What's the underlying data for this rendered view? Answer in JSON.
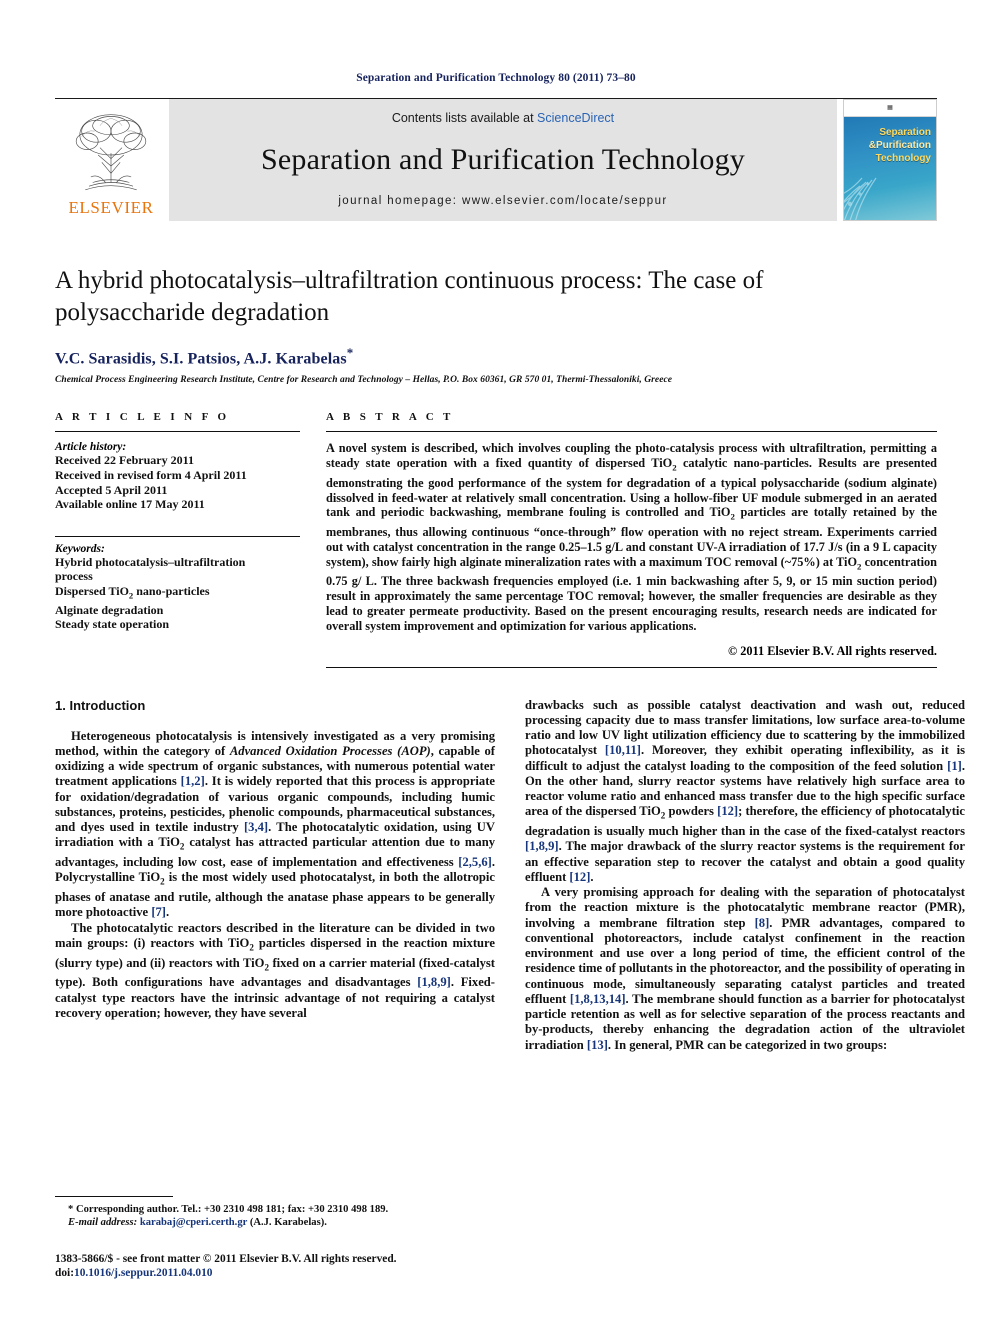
{
  "running_head": "Separation and Purification Technology 80 (2011) 73–80",
  "masthead": {
    "contents_prefix": "Contents lists available at ",
    "sciencedirect": "ScienceDirect",
    "journal_name": "Separation and Purification Technology",
    "homepage": "journal homepage: www.elsevier.com/locate/seppur",
    "publisher_logo_text": "ELSEVIER",
    "cover": {
      "line1": "Separation",
      "line2": "&Purification",
      "line3": "Technology"
    },
    "link_color": "#2a63b5"
  },
  "title_block": {
    "title": "A hybrid photocatalysis–ultrafiltration continuous process: The case of polysaccharide degradation",
    "authors": "V.C. Sarasidis, S.I. Patsios, A.J. Karabelas",
    "corresponding_marker": "*",
    "affiliation": "Chemical Process Engineering Research Institute, Centre for Research and Technology – Hellas, P.O. Box 60361, GR 570 01, Thermi-Thessaloniki, Greece",
    "author_color": "#16225c"
  },
  "article_info": {
    "label": "A R T I C L E   I N F O",
    "history_heading": "Article history:",
    "history": [
      "Received 22 February 2011",
      "Received in revised form 4 April 2011",
      "Accepted 5 April 2011",
      "Available online 17 May 2011"
    ],
    "keywords_heading": "Keywords:",
    "keywords": [
      "Hybrid photocatalysis–ultrafiltration process",
      "Dispersed TiO2 nano-particles",
      "Alginate degradation",
      "Steady state operation"
    ]
  },
  "abstract": {
    "label": "A B S T R A C T",
    "text": "A novel system is described, which involves coupling the photo-catalysis process with ultrafiltration, permitting a steady state operation with a fixed quantity of dispersed TiO2 catalytic nano-particles. Results are presented demonstrating the good performance of the system for degradation of a typical polysaccharide (sodium alginate) dissolved in feed-water at relatively small concentration. Using a hollow-fiber UF module submerged in an aerated tank and periodic backwashing, membrane fouling is controlled and TiO2 particles are totally retained by the membranes, thus allowing continuous “once-through” flow operation with no reject stream. Experiments carried out with catalyst concentration in the range 0.25–1.5 g/L and constant UV-A irradiation of 17.7 J/s (in a 9 L capacity system), show fairly high alginate mineralization rates with a maximum TOC removal (~75%) at TiO2 concentration 0.75 g/L. The three backwash frequencies employed (i.e. 1 min backwashing after 5, 9, or 15 min suction period) result in approximately the same percentage TOC removal; however, the smaller frequencies are desirable as they lead to greater permeate productivity. Based on the present encouraging results, research needs are indicated for overall system improvement and optimization for various applications.",
    "copyright": "© 2011 Elsevier B.V. All rights reserved."
  },
  "body": {
    "section_title": "1. Introduction",
    "left_paragraphs": [
      "Heterogeneous photocatalysis is intensively investigated as a very promising method, within the category of Advanced Oxidation Processes (AOP), capable of oxidizing a wide spectrum of organic substances, with numerous potential water treatment applications [1,2]. It is widely reported that this process is appropriate for oxidation/degradation of various organic compounds, including humic substances, proteins, pesticides, phenolic compounds, pharmaceutical substances, and dyes used in textile industry [3,4]. The photocatalytic oxidation, using UV irradiation with a TiO2 catalyst has attracted particular attention due to many advantages, including low cost, ease of implementation and effectiveness [2,5,6]. Polycrystalline TiO2 is the most widely used photocatalyst, in both the allotropic phases of anatase and rutile, although the anatase phase appears to be generally more photoactive [7].",
      "The photocatalytic reactors described in the literature can be divided in two main groups: (i) reactors with TiO2 particles dispersed in the reaction mixture (slurry type) and (ii) reactors with TiO2 fixed on a carrier material (fixed-catalyst type). Both configurations have advantages and disadvantages [1,8,9]. Fixed-catalyst type reactors have the intrinsic advantage of not requiring a catalyst recovery operation; however, they have several"
    ],
    "right_paragraphs": [
      "drawbacks such as possible catalyst deactivation and wash out, reduced processing capacity due to mass transfer limitations, low surface area-to-volume ratio and low UV light utilization efficiency due to scattering by the immobilized photocatalyst [10,11]. Moreover, they exhibit operating inflexibility, as it is difficult to adjust the catalyst loading to the composition of the feed solution [1]. On the other hand, slurry reactor systems have relatively high surface area to reactor volume ratio and enhanced mass transfer due to the high specific surface area of the dispersed TiO2 powders [12]; therefore, the efficiency of photocatalytic degradation is usually much higher than in the case of the fixed-catalyst reactors [1,8,9]. The major drawback of the slurry reactor systems is the requirement for an effective separation step to recover the catalyst and obtain a good quality effluent [12].",
      "A very promising approach for dealing with the separation of photocatalyst from the reaction mixture is the photocatalytic membrane reactor (PMR), involving a membrane filtration step [8]. PMR advantages, compared to conventional photoreactors, include catalyst confinement in the reaction environment and use over a long period of time, the efficient control of the residence time of pollutants in the photoreactor, and the possibility of operating in continuous mode, simultaneously separating catalyst particles and treated effluent [1,8,13,14]. The membrane should function as a barrier for photocatalyst particle retention as well as for selective separation of the process reactants and by-products, thereby enhancing the degradation action of the ultraviolet irradiation [13]. In general, PMR can be categorized in two groups:"
    ]
  },
  "footnote": {
    "marker": "*",
    "line1": "Corresponding author. Tel.: +30 2310 498 181; fax: +30 2310 498 189.",
    "email_label": "E-mail address:",
    "email": "karabaj@cperi.certh.gr",
    "email_suffix": "(A.J. Karabelas)."
  },
  "imprint": {
    "line1": "1383-5866/$ - see front matter © 2011 Elsevier B.V. All rights reserved.",
    "doi_label": "doi:",
    "doi": "10.1016/j.seppur.2011.04.010"
  }
}
